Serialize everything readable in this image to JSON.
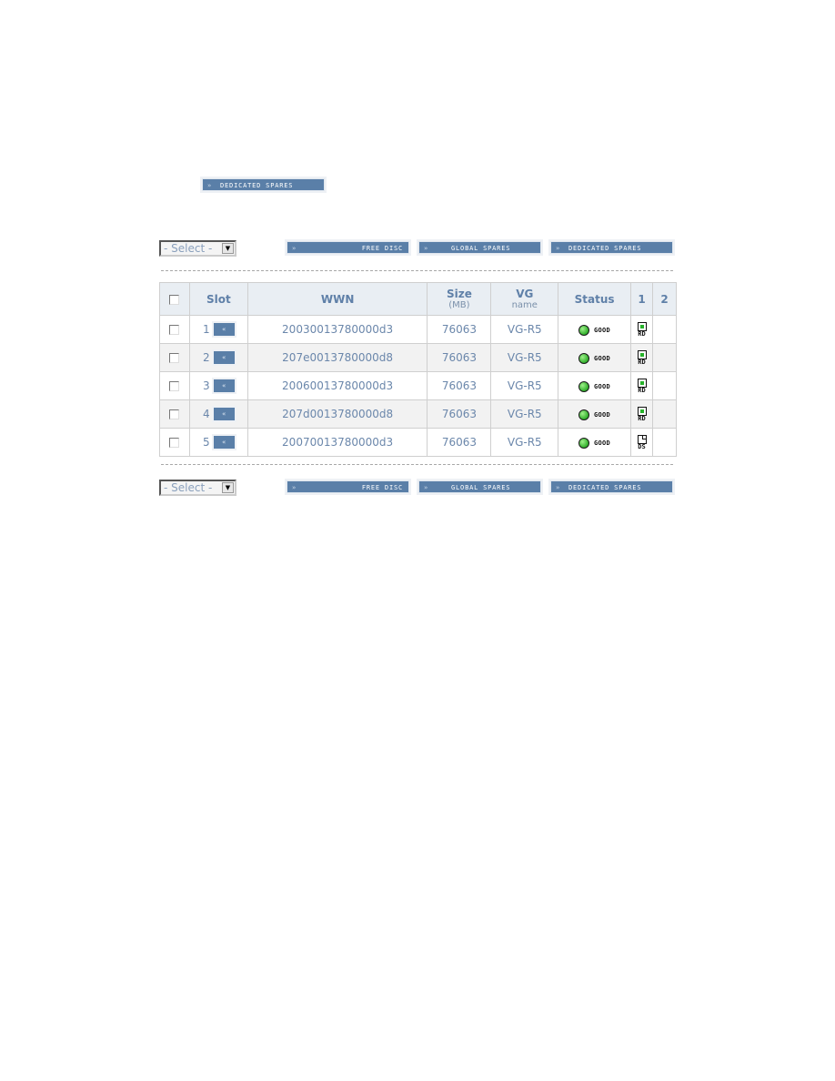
{
  "top_button": {
    "arrow": "»",
    "label": "DEDICATED SPARES"
  },
  "toolbar_top": {
    "select_value": "- Select -",
    "buttons": [
      {
        "arrow": "»",
        "label": "FREE DISC"
      },
      {
        "arrow": "»",
        "label": "GLOBAL SPARES"
      },
      {
        "arrow": "»",
        "label": "DEDICATED SPARES"
      }
    ]
  },
  "toolbar_bottom": {
    "select_value": "- Select -",
    "buttons": [
      {
        "arrow": "»",
        "label": "FREE DISC"
      },
      {
        "arrow": "»",
        "label": "GLOBAL SPARES"
      },
      {
        "arrow": "»",
        "label": "DEDICATED SPARES"
      }
    ]
  },
  "table": {
    "headers": {
      "slot": "Slot",
      "wwn": "WWN",
      "size": "Size",
      "size_unit": "(MB)",
      "vg": "VG",
      "vg_sub": "name",
      "status": "Status",
      "col1": "1",
      "col2": "2"
    },
    "slot_button_icon": "«",
    "status_colors": {
      "good": "#2fae2a"
    },
    "rows": [
      {
        "slot": "1",
        "wwn": "20030013780000d3",
        "size": "76063",
        "vg": "VG-R5",
        "status": "GOOD",
        "disk1": "RD",
        "disk2": ""
      },
      {
        "slot": "2",
        "wwn": "207e0013780000d8",
        "size": "76063",
        "vg": "VG-R5",
        "status": "GOOD",
        "disk1": "RD",
        "disk2": ""
      },
      {
        "slot": "3",
        "wwn": "20060013780000d3",
        "size": "76063",
        "vg": "VG-R5",
        "status": "GOOD",
        "disk1": "RD",
        "disk2": ""
      },
      {
        "slot": "4",
        "wwn": "207d0013780000d8",
        "size": "76063",
        "vg": "VG-R5",
        "status": "GOOD",
        "disk1": "RD",
        "disk2": ""
      },
      {
        "slot": "5",
        "wwn": "20070013780000d3",
        "size": "76063",
        "vg": "VG-R5",
        "status": "GOOD",
        "disk1": "DS",
        "disk2": ""
      }
    ]
  }
}
